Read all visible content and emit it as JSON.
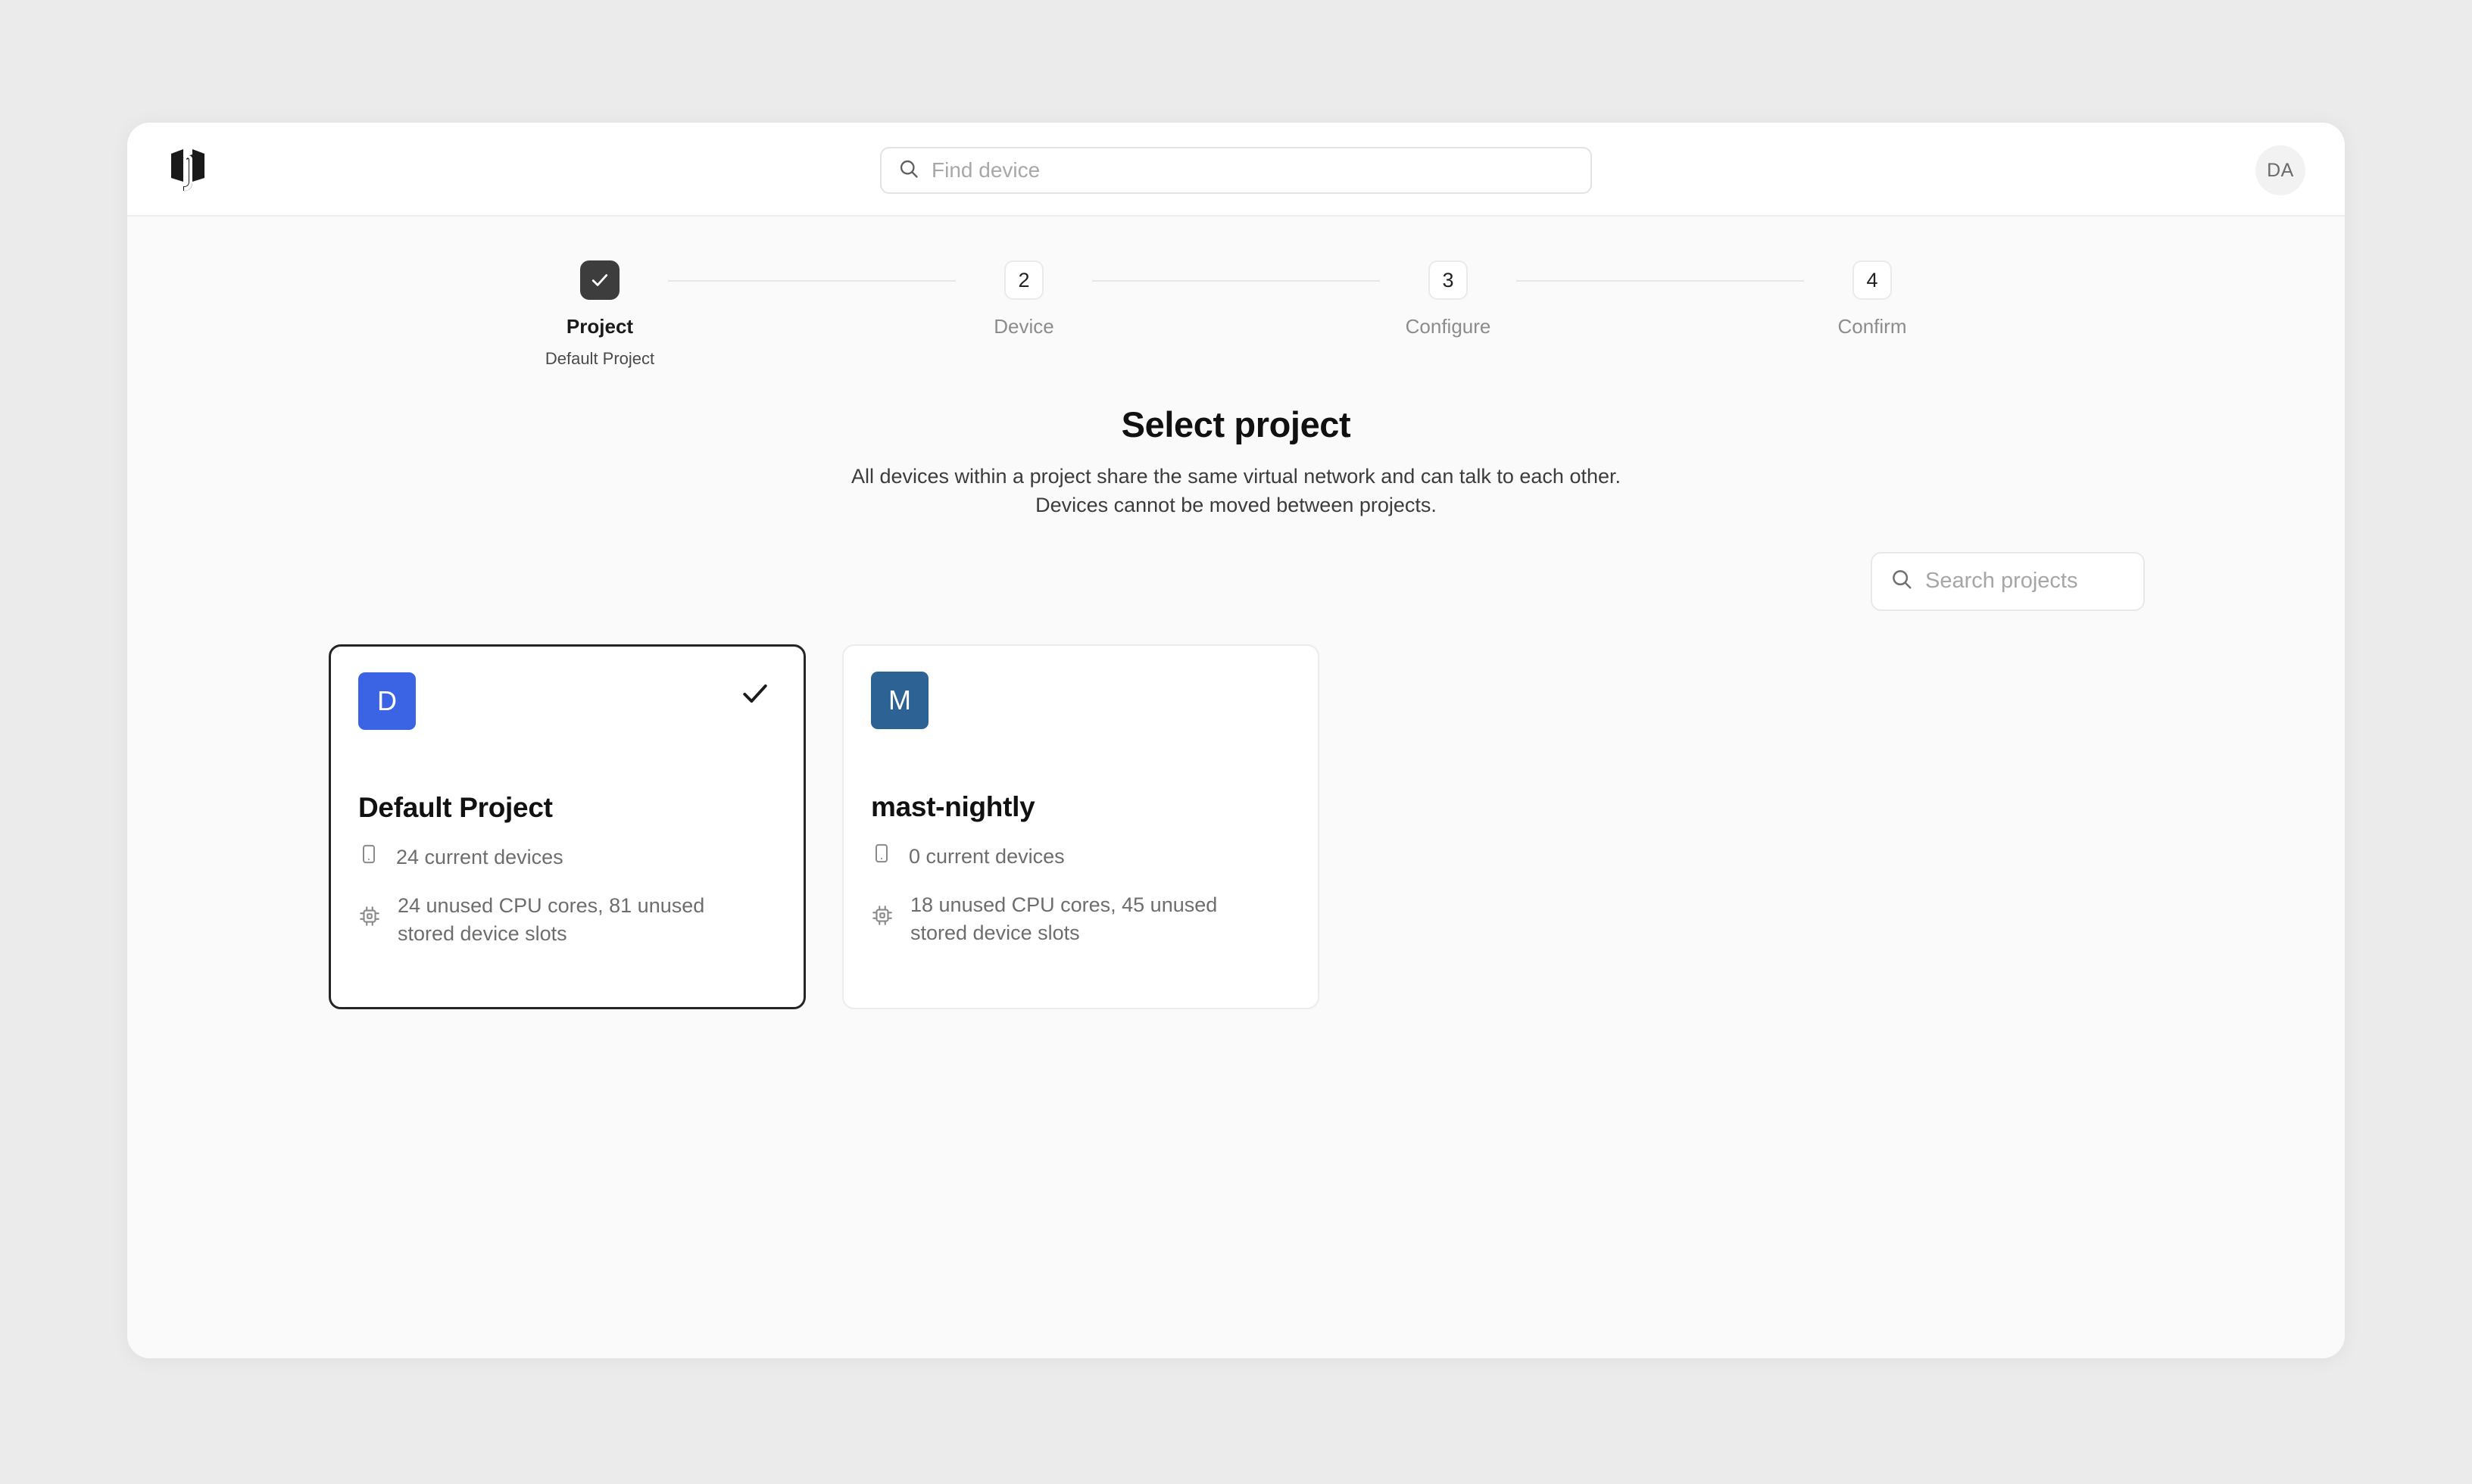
{
  "topbar": {
    "logo_name": "juicebox-logo",
    "search": {
      "placeholder": "Find device",
      "value": "",
      "icon": "search-icon"
    },
    "user_initials": "DA"
  },
  "stepper": {
    "steps": [
      {
        "number": "1",
        "glyph": "check",
        "label": "Project",
        "sublabel": "Default Project",
        "state": "done"
      },
      {
        "number": "2",
        "glyph": "2",
        "label": "Device",
        "sublabel": "",
        "state": "todo"
      },
      {
        "number": "3",
        "glyph": "3",
        "label": "Configure",
        "sublabel": "",
        "state": "todo"
      },
      {
        "number": "4",
        "glyph": "4",
        "label": "Confirm",
        "sublabel": "",
        "state": "todo"
      }
    ]
  },
  "main": {
    "title": "Select project",
    "subtitle_line1": "All devices within a project share the same virtual network and can talk to each other.",
    "subtitle_line2": "Devices cannot be moved between projects.",
    "search": {
      "placeholder": "Search projects",
      "value": "",
      "icon": "search-icon"
    },
    "projects": [
      {
        "initial": "D",
        "badge_color": "#3a64e3",
        "name": "Default Project",
        "devices": "24 current devices",
        "resources": "24 unused CPU cores, 81 unused stored device slots",
        "selected": true
      },
      {
        "initial": "M",
        "badge_color": "#2d6295",
        "name": "mast-nightly",
        "devices": "0 current devices",
        "resources": "18 unused CPU cores, 45 unused stored device slots",
        "selected": false
      }
    ]
  },
  "colors": {
    "page_background": "#ebebeb",
    "window_background": "#fafafa",
    "surface": "#ffffff",
    "step_active": "#3d3d3d",
    "selected_border": "#252525",
    "muted_text": "#6d6d6d"
  }
}
